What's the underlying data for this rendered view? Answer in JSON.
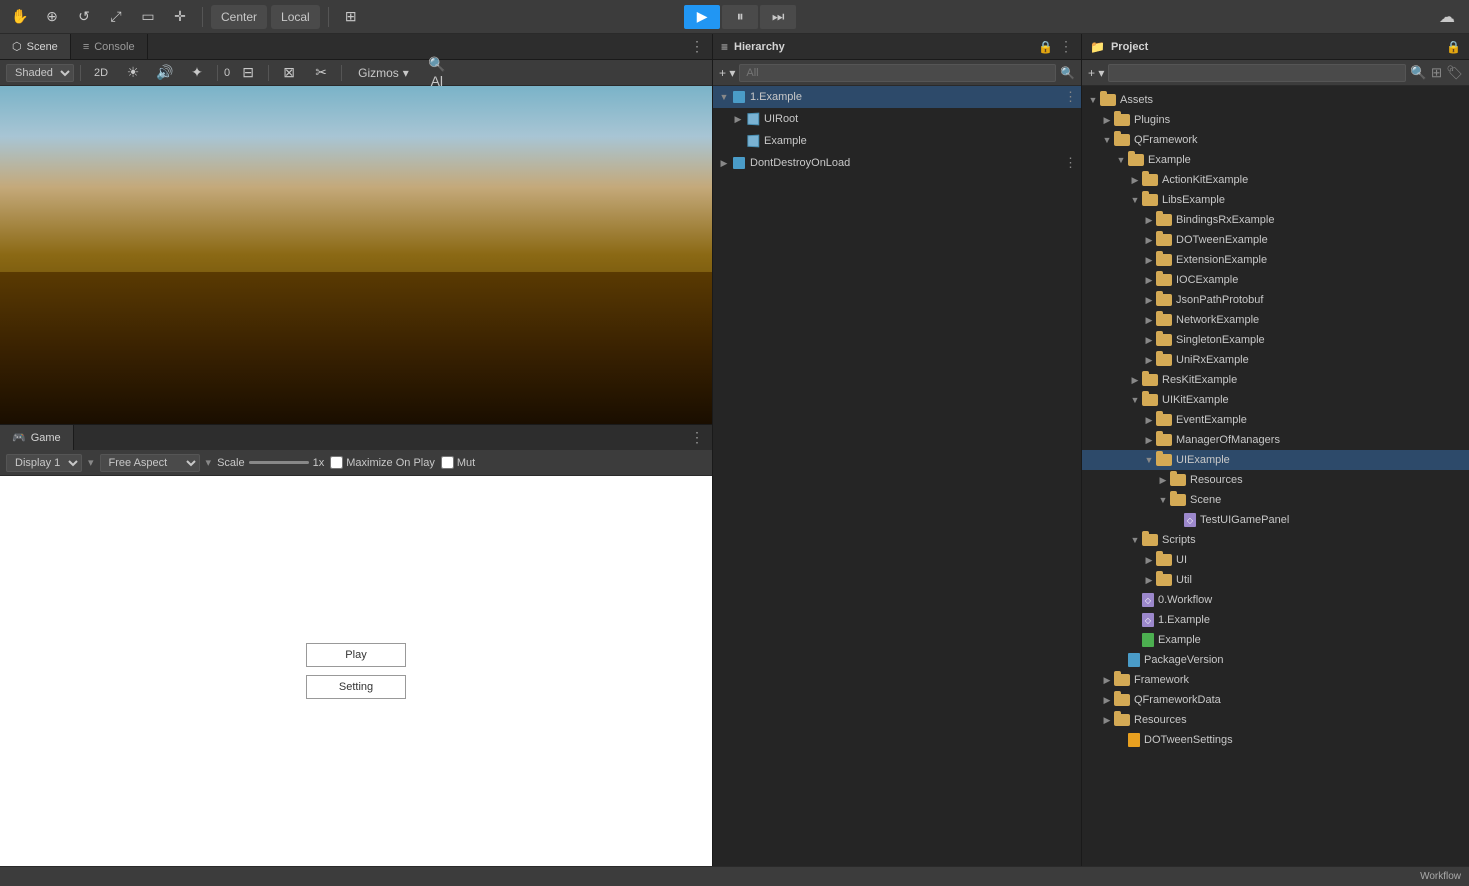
{
  "toolbar": {
    "hand_tool": "✋",
    "move_tool": "⊕",
    "rotate_tool": "↺",
    "scale_tool": "⤢",
    "rect_tool": "▭",
    "transform_tool": "✛",
    "pivot_mode": "Center",
    "transform_mode": "Local",
    "grid_tool": "⊞",
    "play": "▶",
    "pause": "⏸",
    "step": "⏭",
    "cloud": "☁"
  },
  "scene_panel": {
    "tab_label": "Scene",
    "console_tab": "Console",
    "shading_mode": "Shaded",
    "is_2d": "2D",
    "gizmos_label": "Gizmos",
    "search_placeholder": "Al"
  },
  "game_panel": {
    "tab_label": "Game",
    "display_label": "Display 1",
    "aspect_label": "Free Aspect",
    "scale_label": "Scale",
    "scale_value": "1x",
    "maximize_label": "Maximize On Play",
    "mute_label": "Mut",
    "play_button": "Play",
    "setting_button": "Setting"
  },
  "hierarchy_panel": {
    "title": "Hierarchy",
    "search_placeholder": "All",
    "items": [
      {
        "id": "example-scene",
        "label": "1.Example",
        "indent": 0,
        "arrow": "▼",
        "has_menu": true,
        "type": "scene"
      },
      {
        "id": "ui-root",
        "label": "UIRoot",
        "indent": 1,
        "arrow": "▶",
        "has_menu": false,
        "type": "gameobject"
      },
      {
        "id": "example",
        "label": "Example",
        "indent": 1,
        "arrow": "",
        "has_menu": false,
        "type": "gameobject"
      },
      {
        "id": "dontdestroy",
        "label": "DontDestroyOnLoad",
        "indent": 0,
        "arrow": "▶",
        "has_menu": true,
        "type": "scene"
      }
    ]
  },
  "project_panel": {
    "title": "Project",
    "search_placeholder": "",
    "items": [
      {
        "id": "assets",
        "label": "Assets",
        "indent": 0,
        "arrow": "▼",
        "type": "folder"
      },
      {
        "id": "plugins",
        "label": "Plugins",
        "indent": 1,
        "arrow": "▶",
        "type": "folder"
      },
      {
        "id": "qframework",
        "label": "QFramework",
        "indent": 1,
        "arrow": "▼",
        "type": "folder"
      },
      {
        "id": "example-folder",
        "label": "Example",
        "indent": 2,
        "arrow": "▼",
        "type": "folder"
      },
      {
        "id": "actionkit",
        "label": "ActionKitExample",
        "indent": 3,
        "arrow": "▶",
        "type": "folder"
      },
      {
        "id": "libsexample",
        "label": "LibsExample",
        "indent": 3,
        "arrow": "▼",
        "type": "folder"
      },
      {
        "id": "bindingsrx",
        "label": "BindingsRxExample",
        "indent": 4,
        "arrow": "▶",
        "type": "folder"
      },
      {
        "id": "dotween",
        "label": "DOTweenExample",
        "indent": 4,
        "arrow": "▶",
        "type": "folder"
      },
      {
        "id": "extension",
        "label": "ExtensionExample",
        "indent": 4,
        "arrow": "▶",
        "type": "folder"
      },
      {
        "id": "ioc",
        "label": "IOCExample",
        "indent": 4,
        "arrow": "▶",
        "type": "folder"
      },
      {
        "id": "jsonpath",
        "label": "JsonPathProtobuf",
        "indent": 4,
        "arrow": "▶",
        "type": "folder"
      },
      {
        "id": "network",
        "label": "NetworkExample",
        "indent": 4,
        "arrow": "▶",
        "type": "folder"
      },
      {
        "id": "singleton",
        "label": "SingletonExample",
        "indent": 4,
        "arrow": "▶",
        "type": "folder"
      },
      {
        "id": "unirx",
        "label": "UniRxExample",
        "indent": 4,
        "arrow": "▶",
        "type": "folder"
      },
      {
        "id": "reskit",
        "label": "ResKitExample",
        "indent": 3,
        "arrow": "▶",
        "type": "folder"
      },
      {
        "id": "uikitexample",
        "label": "UIKitExample",
        "indent": 3,
        "arrow": "▼",
        "type": "folder"
      },
      {
        "id": "eventexample",
        "label": "EventExample",
        "indent": 4,
        "arrow": "▶",
        "type": "folder"
      },
      {
        "id": "managerofmanagers",
        "label": "ManagerOfManagers",
        "indent": 4,
        "arrow": "▶",
        "type": "folder"
      },
      {
        "id": "uiexample",
        "label": "UIExample",
        "indent": 4,
        "arrow": "▼",
        "type": "folder"
      },
      {
        "id": "resources",
        "label": "Resources",
        "indent": 5,
        "arrow": "▶",
        "type": "folder"
      },
      {
        "id": "scene",
        "label": "Scene",
        "indent": 5,
        "arrow": "▼",
        "type": "folder"
      },
      {
        "id": "testuigamepanel",
        "label": "TestUIGamePanel",
        "indent": 6,
        "arrow": "",
        "type": "scene"
      },
      {
        "id": "scripts",
        "label": "Scripts",
        "indent": 3,
        "arrow": "▼",
        "type": "folder"
      },
      {
        "id": "ui-folder",
        "label": "UI",
        "indent": 4,
        "arrow": "▶",
        "type": "folder"
      },
      {
        "id": "util-folder",
        "label": "Util",
        "indent": 4,
        "arrow": "▶",
        "type": "folder"
      },
      {
        "id": "workflow-file",
        "label": "0.Workflow",
        "indent": 3,
        "arrow": "",
        "type": "scene"
      },
      {
        "id": "example-file",
        "label": "1.Example",
        "indent": 3,
        "arrow": "",
        "type": "scene"
      },
      {
        "id": "example-script",
        "label": "Example",
        "indent": 3,
        "arrow": "",
        "type": "script"
      },
      {
        "id": "packageversion",
        "label": "PackageVersion",
        "indent": 2,
        "arrow": "",
        "type": "file"
      },
      {
        "id": "framework",
        "label": "Framework",
        "indent": 1,
        "arrow": "▶",
        "type": "folder"
      },
      {
        "id": "qframeworkdata",
        "label": "QFrameworkData",
        "indent": 1,
        "arrow": "▶",
        "type": "folder"
      },
      {
        "id": "resources-root",
        "label": "Resources",
        "indent": 1,
        "arrow": "▶",
        "type": "folder"
      },
      {
        "id": "dotweensettings",
        "label": "DOTweenSettings",
        "indent": 2,
        "arrow": "",
        "type": "file"
      }
    ]
  },
  "bottom_bar": {
    "workflow_label": "Workflow"
  }
}
